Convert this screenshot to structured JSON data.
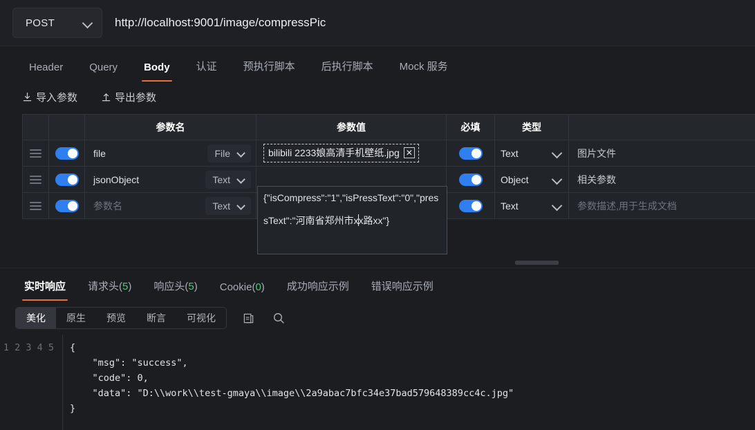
{
  "urlbar": {
    "method": "POST",
    "url": "http://localhost:9001/image/compressPic",
    "chevron_icon": "chevron-down-icon"
  },
  "request_tabs": [
    {
      "label": "Header",
      "active": false
    },
    {
      "label": "Query",
      "active": false
    },
    {
      "label": "Body",
      "active": true
    },
    {
      "label": "认证",
      "active": false
    },
    {
      "label": "预执行脚本",
      "active": false
    },
    {
      "label": "后执行脚本",
      "active": false
    },
    {
      "label": "Mock 服务",
      "active": false
    }
  ],
  "io_buttons": [
    {
      "label": "导入参数",
      "icon": "import-arrow-down-icon"
    },
    {
      "label": "导出参数",
      "icon": "export-arrow-up-icon"
    }
  ],
  "param_table": {
    "headers": [
      "",
      "",
      "参数名",
      "参数值",
      "必填",
      "类型",
      ""
    ],
    "rows": [
      {
        "enabled": true,
        "name": "file",
        "name_placeholder": "参数名",
        "name_type": "File",
        "value_kind": "file",
        "file_name": "bilibili 2233娘高清手机壁纸.jpg",
        "file_remove_label": "✕",
        "required": true,
        "type": "Text",
        "desc": "图片文件",
        "desc_placeholder": "参数描述,用于生成文档"
      },
      {
        "enabled": true,
        "name": "jsonObject",
        "name_placeholder": "参数名",
        "name_type": "Text",
        "value_kind": "text",
        "required": true,
        "type": "Object",
        "desc": "相关参数",
        "desc_placeholder": "参数描述,用于生成文档"
      },
      {
        "enabled": true,
        "name": "",
        "name_placeholder": "参数名",
        "name_type": "Text",
        "value_kind": "text",
        "required": true,
        "type": "Text",
        "desc": "",
        "desc_placeholder": "参数描述,用于生成文档"
      }
    ],
    "focused_value": {
      "part1": "{\"isCompress\":\"1\",\"isPressText\":\"0\",\"pressText\":\"河南省郑州市x",
      "part2": "x路xx\"}"
    }
  },
  "response_tabs": [
    {
      "label": "实时响应",
      "count": "",
      "active": true
    },
    {
      "label": "请求头",
      "count": "5",
      "active": false
    },
    {
      "label": "响应头",
      "count": "5",
      "active": false
    },
    {
      "label": "Cookie",
      "count": "0",
      "active": false
    },
    {
      "label": "成功响应示例",
      "count": "",
      "active": false
    },
    {
      "label": "错误响应示例",
      "count": "",
      "active": false
    }
  ],
  "view_modes": [
    {
      "label": "美化",
      "active": true
    },
    {
      "label": "原生",
      "active": false
    },
    {
      "label": "预览",
      "active": false
    },
    {
      "label": "断言",
      "active": false
    },
    {
      "label": "可视化",
      "active": false
    }
  ],
  "view_icons": [
    {
      "name": "copy-icon"
    },
    {
      "name": "search-icon"
    }
  ],
  "response_body": {
    "line_numbers": "1\n2\n3\n4\n5",
    "text": "{\n    \"msg\": \"success\",\n    \"code\": 0,\n    \"data\": \"D:\\\\work\\\\test-gmaya\\\\image\\\\2a9abac7bfc34e37bad579648389cc4c.jpg\"\n}"
  },
  "colors": {
    "accent": "#e8703a",
    "toggle_on": "#2f7ff0",
    "count_green": "#4ec97a",
    "background": "#1b1d21"
  }
}
